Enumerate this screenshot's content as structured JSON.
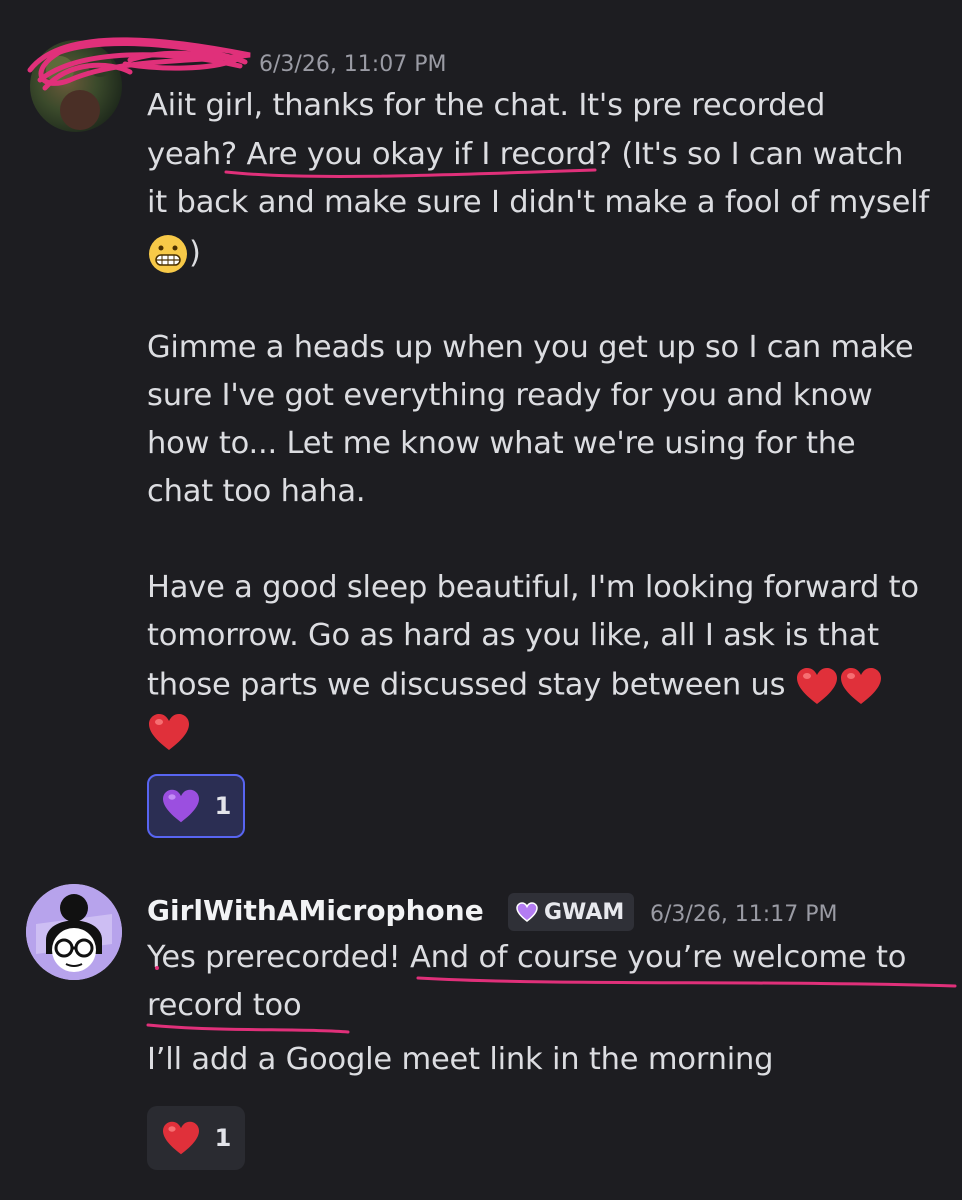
{
  "message1": {
    "timestamp": "6/3/26, 11:07 PM",
    "lines": [
      "Aiit girl, thanks for the chat. It's pre recorded",
      "yeah? Are you okay if I record? (It's so I can watch",
      "it back and make sure I didn't make a fool of myself",
      ")",
      "Gimme a heads up when you get up so I can make",
      "sure I've got everything ready for you and know",
      "how to... Let me know what we're using for the",
      "chat too haha.",
      "Have a good sleep beautiful, I'm looking forward to",
      "tomorrow. Go as hard as you like, all I ask is that",
      "those parts we discussed stay between us"
    ],
    "reaction": {
      "emoji": "purple-heart",
      "count": "1"
    }
  },
  "message2": {
    "username": "GirlWithAMicrophone",
    "tag": "GWAM",
    "timestamp": "6/3/26, 11:17 PM",
    "lines": [
      "Yes prerecorded! And of course you’re welcome to",
      "record too",
      "I’ll add a Google meet link in the morning"
    ],
    "reaction": {
      "emoji": "red-heart",
      "count": "1"
    }
  },
  "colors": {
    "background": "#1d1d21",
    "text": "#dcdde1",
    "muted": "#9a9ba4",
    "annotation": "#e0307a",
    "reaction_active_border": "#5865f2"
  }
}
